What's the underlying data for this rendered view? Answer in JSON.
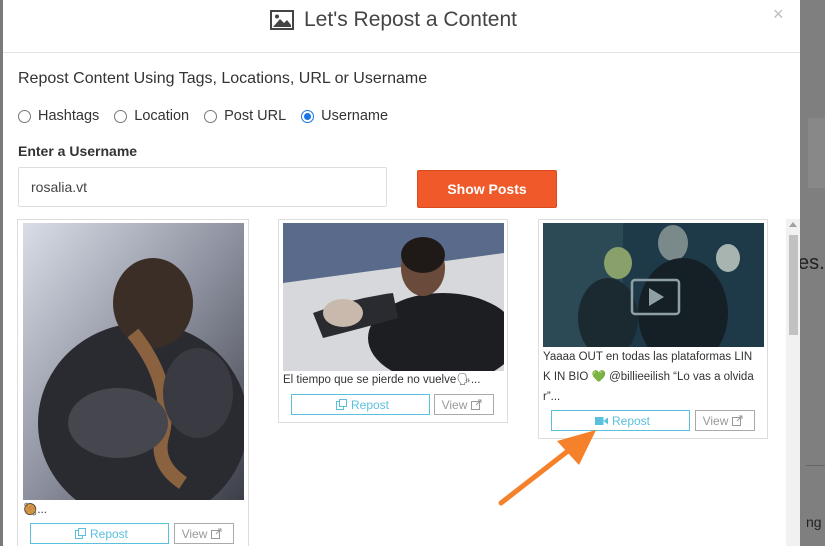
{
  "background": {
    "partial_text": "es.",
    "partial_text2": "ng"
  },
  "modal": {
    "title": "Let's Repost a Content",
    "close": "×",
    "subtitle": "Repost Content Using Tags, Locations, URL or Username",
    "options": [
      {
        "label": "Hashtags",
        "checked": false
      },
      {
        "label": "Location",
        "checked": false
      },
      {
        "label": "Post URL",
        "checked": false
      },
      {
        "label": "Username",
        "checked": true
      }
    ],
    "username_label": "Enter a Username",
    "username_value": "rosalia.vt",
    "show_posts": "Show Posts"
  },
  "posts": [
    {
      "caption": "🥘...",
      "repost": "Repost",
      "view": "View",
      "type": "image"
    },
    {
      "caption": "El tiempo que se pierde no vuelve🗣...",
      "repost": "Repost",
      "view": "View",
      "type": "image"
    },
    {
      "caption_line1": "Yaaaa OUT en todas las plataformas LIN",
      "caption_line2": "K IN BIO 💚 @billieeilish “Lo vas a olvida",
      "caption_line3": "r”...",
      "repost": "Repost",
      "view": "View",
      "type": "video"
    }
  ],
  "colors": {
    "accent": "#f05a2b",
    "repost": "#5bc0de",
    "arrow": "#f5822a"
  }
}
